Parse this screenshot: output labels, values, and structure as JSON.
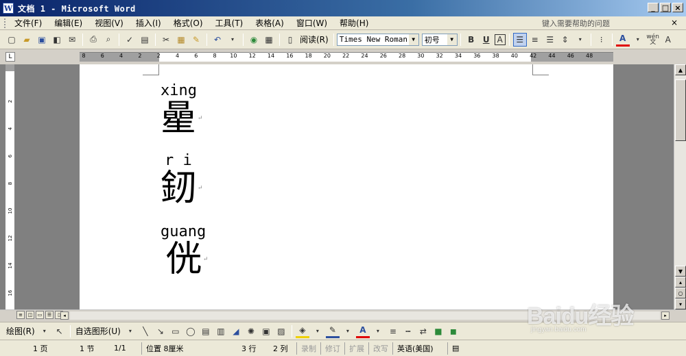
{
  "window": {
    "title": "文档 1 - Microsoft Word",
    "app_icon": "W"
  },
  "menu": {
    "items": [
      "文件(F)",
      "编辑(E)",
      "视图(V)",
      "插入(I)",
      "格式(O)",
      "工具(T)",
      "表格(A)",
      "窗口(W)",
      "帮助(H)"
    ],
    "help_placeholder": "键入需要帮助的问题",
    "close_glyph": "×"
  },
  "toolbar": {
    "read_label": "阅读(R)",
    "font_name": "Times New Roman",
    "font_size": "初号",
    "bold": "B",
    "underline": "U",
    "char_border": "A",
    "font_color": "A",
    "wen": "wén\n文",
    "grow_font": "A"
  },
  "ruler": {
    "ticks": [
      "8",
      "6",
      "4",
      "2",
      "2",
      "4",
      "6",
      "8",
      "10",
      "12",
      "14",
      "16",
      "18",
      "20",
      "22",
      "24",
      "26",
      "28",
      "30",
      "32",
      "34",
      "36",
      "38",
      "40",
      "42",
      "44",
      "46",
      "48"
    ],
    "vticks": [
      "2",
      "4",
      "6",
      "8",
      "10",
      "12",
      "14",
      "16"
    ]
  },
  "document": {
    "entries": [
      {
        "pinyin": "xing",
        "hanzi": "曐"
      },
      {
        "pinyin": "r i",
        "hanzi": "釰"
      },
      {
        "pinyin": "guang",
        "hanzi": "侊"
      }
    ],
    "para_mark": "↵"
  },
  "drawbar": {
    "draw_label": "绘图(R)",
    "autoshapes_label": "自选图形(U)"
  },
  "status": {
    "page": "1 页",
    "section": "1 节",
    "page_of": "1/1",
    "position": "位置 8厘米",
    "line": "3 行",
    "column": "2 列",
    "rec": "录制",
    "trk": "修订",
    "ext": "扩展",
    "ovr": "改写",
    "language": "英语(美国)"
  },
  "watermark": {
    "logo": "Baidu经验",
    "url": "jingyan.baidu.com"
  },
  "colors": {
    "titlebar_start": "#0a246a",
    "titlebar_end": "#a6caf0",
    "font_color_bar": "#e00000"
  }
}
